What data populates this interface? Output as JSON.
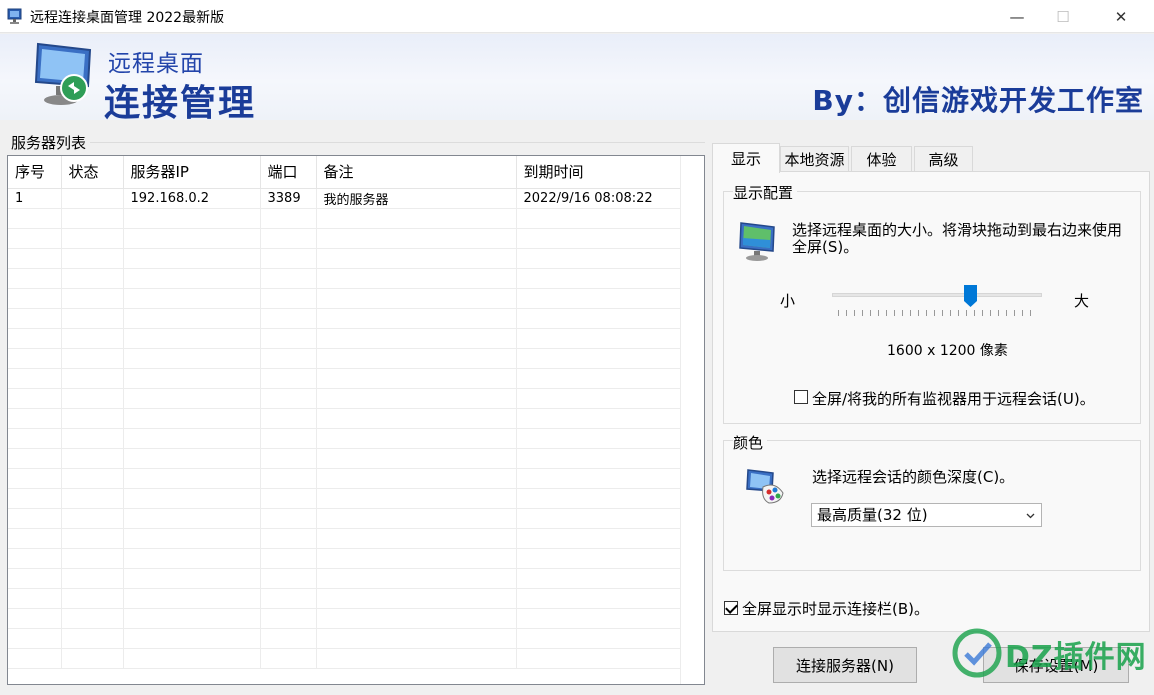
{
  "window": {
    "title": "远程连接桌面管理 2022最新版",
    "controls": {
      "minimize": "—",
      "maximize": "☐",
      "close": "✕"
    }
  },
  "banner": {
    "subtitle": "远程桌面",
    "title": "连接管理",
    "author": "By：创信游戏开发工作室",
    "icon": "remote-desktop-monitor-icon"
  },
  "server_list": {
    "label": "服务器列表",
    "columns": [
      "序号",
      "状态",
      "服务器IP",
      "端口",
      "备注",
      "到期时间"
    ],
    "rows": [
      [
        "1",
        "",
        "192.168.0.2",
        "3389",
        "我的服务器",
        "2022/9/16 08:08:22"
      ]
    ]
  },
  "tabs": [
    {
      "label": "显示",
      "active": true
    },
    {
      "label": "本地资源",
      "active": false
    },
    {
      "label": "体验",
      "active": false
    },
    {
      "label": "高级",
      "active": false
    }
  ],
  "display": {
    "group_label": "显示配置",
    "description": "选择远程桌面的大小。将滑块拖动到最右边来使用全屏(S)。",
    "slider_min_label": "小",
    "slider_max_label": "大",
    "slider_level": 0.66,
    "resolution": "1600 x 1200 像素",
    "fullscreen_all_monitors": {
      "label": "全屏/将我的所有监视器用于远程会话(U)。",
      "checked": false
    }
  },
  "color": {
    "group_label": "颜色",
    "description": "选择远程会话的颜色深度(C)。",
    "selected": "最高质量(32 位)"
  },
  "connection_bar": {
    "label": "全屏显示时显示连接栏(B)。",
    "checked": true
  },
  "buttons": {
    "connect": "连接服务器(N)",
    "save": "保存设置(M)"
  },
  "watermark": "DZ插件网",
  "colors": {
    "banner_text": "#1a3c99",
    "watermark": "#18a24b"
  }
}
